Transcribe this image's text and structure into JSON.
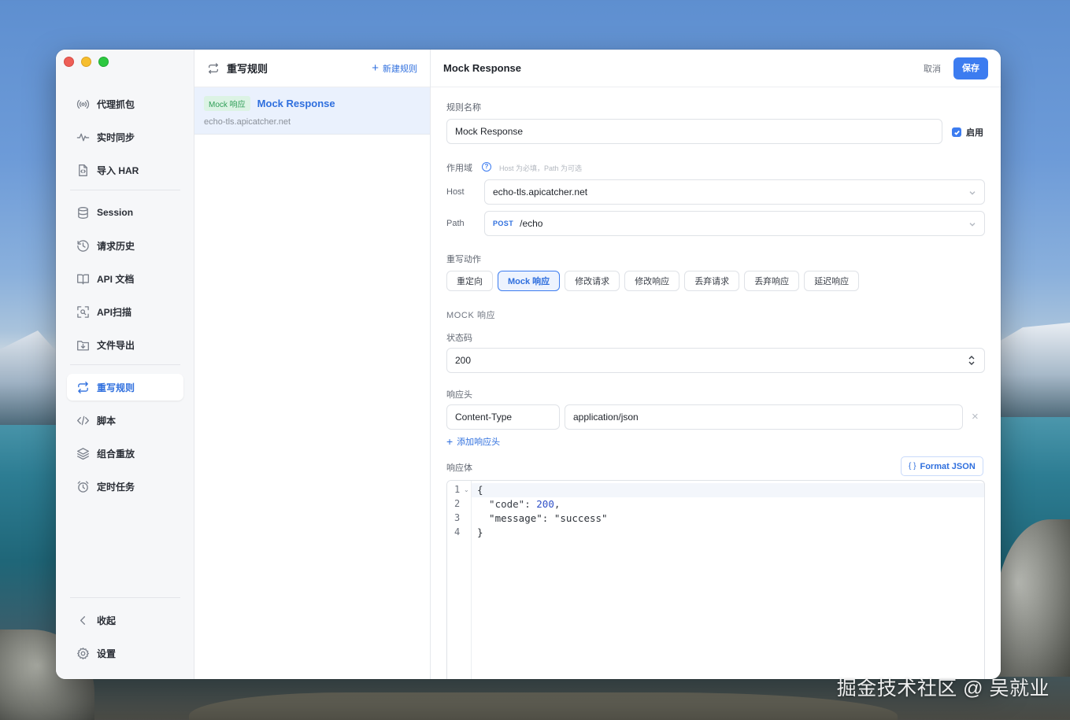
{
  "sidebar": {
    "group1": [
      {
        "label": "代理抓包",
        "icon": "broadcast-icon"
      },
      {
        "label": "实时同步",
        "icon": "pulse-icon"
      },
      {
        "label": "导入 HAR",
        "icon": "file-code-icon"
      }
    ],
    "group2": [
      {
        "label": "Session",
        "icon": "database-icon"
      },
      {
        "label": "请求历史",
        "icon": "history-icon"
      },
      {
        "label": "API 文档",
        "icon": "book-icon"
      },
      {
        "label": "API扫描",
        "icon": "scan-icon"
      },
      {
        "label": "文件导出",
        "icon": "folder-download-icon"
      }
    ],
    "group3": [
      {
        "label": "重写规则",
        "icon": "rewrite-icon",
        "active": true
      },
      {
        "label": "脚本",
        "icon": "code-icon"
      },
      {
        "label": "组合重放",
        "icon": "layers-icon"
      },
      {
        "label": "定时任务",
        "icon": "alarm-icon"
      }
    ],
    "collapse_label": "收起",
    "settings_label": "设置"
  },
  "rules": {
    "title": "重写规则",
    "new_label": "新建规则",
    "items": [
      {
        "badge": "Mock 响应",
        "name": "Mock Response",
        "host": "echo-tls.apicatcher.net"
      }
    ]
  },
  "editor": {
    "title": "Mock Response",
    "cancel_label": "取消",
    "save_label": "保存",
    "rule_name_label": "规则名称",
    "rule_name_value": "Mock Response",
    "enable_label": "启用",
    "scope_label": "作用域",
    "scope_hint": "Host 为必填，Path 为可选",
    "host_label": "Host",
    "host_value": "echo-tls.apicatcher.net",
    "path_label": "Path",
    "path_method": "POST",
    "path_value": "/echo",
    "action_label": "重写动作",
    "actions": [
      {
        "label": "重定向",
        "selected": false
      },
      {
        "label": "Mock 响应",
        "selected": true
      },
      {
        "label": "修改请求",
        "selected": false
      },
      {
        "label": "修改响应",
        "selected": false
      },
      {
        "label": "丢弃请求",
        "selected": false
      },
      {
        "label": "丢弃响应",
        "selected": false
      },
      {
        "label": "延迟响应",
        "selected": false
      }
    ],
    "mock_section_title": "MOCK 响应",
    "status_label": "状态码",
    "status_value": "200",
    "headers_label": "响应头",
    "header_rows": [
      {
        "name": "Content-Type",
        "value": "application/json"
      }
    ],
    "add_header_label": "添加响应头",
    "body_label": "响应体",
    "format_label": "Format JSON",
    "format_icon_text": "{ }",
    "body_lines": [
      "{",
      "  \"code\": 200,",
      "  \"message\": \"success\"",
      "}"
    ],
    "line_numbers": [
      "1",
      "2",
      "3",
      "4"
    ]
  },
  "watermark": "掘金技术社区 @ 吴就业",
  "colors": {
    "accent": "#3c7cf0",
    "badge_green": "#2f9e57",
    "sidebar_bg": "#f6f7f9"
  }
}
